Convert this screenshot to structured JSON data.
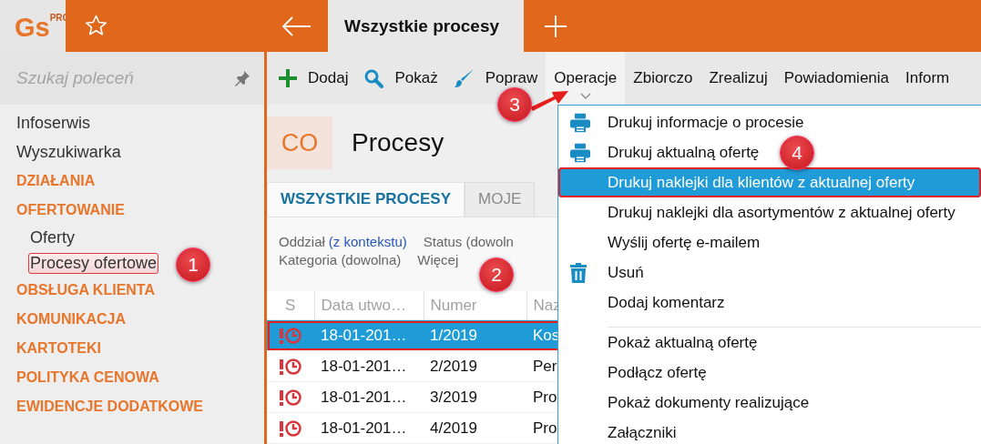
{
  "app": {
    "logo": "Gs",
    "logo_badge": "PRO"
  },
  "top_tabs": [
    {
      "label": "Wszystkie procesy",
      "selected": true
    }
  ],
  "search": {
    "placeholder": "Szukaj poleceń"
  },
  "toolbar": [
    {
      "label": "Dodaj",
      "kind": "add",
      "expanded": false
    },
    {
      "label": "Pokaż",
      "kind": "view",
      "expanded": false
    },
    {
      "label": "Popraw",
      "kind": "edit",
      "expanded": false
    },
    {
      "label": "Operacje",
      "kind": "text",
      "expanded": true
    },
    {
      "label": "Zbiorczo",
      "kind": "text",
      "expanded": false
    },
    {
      "label": "Zrealizuj",
      "kind": "text",
      "expanded": false
    },
    {
      "label": "Powiadomienia",
      "kind": "text",
      "expanded": false
    },
    {
      "label": "Inform",
      "kind": "text",
      "expanded": false
    }
  ],
  "sidebar": {
    "items": [
      {
        "label": "Infoserwis",
        "kind": "link",
        "outlined": false
      },
      {
        "label": "Wyszukiwarka",
        "kind": "link",
        "outlined": false
      },
      {
        "label": "DZIAŁANIA",
        "kind": "section",
        "outlined": false
      },
      {
        "label": "OFERTOWANIE",
        "kind": "section",
        "outlined": false,
        "children": [
          {
            "label": "Oferty",
            "kind": "link",
            "outlined": false
          },
          {
            "label": "Procesy ofertowe",
            "kind": "link",
            "outlined": true
          }
        ]
      },
      {
        "label": "OBSŁUGA KLIENTA",
        "kind": "section",
        "outlined": false
      },
      {
        "label": "KOMUNIKACJA",
        "kind": "section",
        "outlined": false
      },
      {
        "label": "KARTOTEKI",
        "kind": "section",
        "outlined": false
      },
      {
        "label": "POLITYKA CENOWA",
        "kind": "section",
        "outlined": false
      },
      {
        "label": "EWIDENCJE DODATKOWE",
        "kind": "section",
        "outlined": false
      }
    ]
  },
  "content": {
    "badge": "CO",
    "title": "Procesy",
    "tabs": [
      {
        "label": "WSZYSTKIE PROCESY",
        "selected": true
      },
      {
        "label": "MOJE",
        "selected": false
      }
    ],
    "filters": [
      [
        {
          "label": "Oddział",
          "value": "(z kontekstu)"
        },
        {
          "label": "Status (dowoln"
        }
      ],
      [
        {
          "label": "Kategoria (dowolna)"
        },
        {
          "label": "Więcej"
        }
      ]
    ]
  },
  "table": {
    "status_column": "S",
    "columns": [
      "Data utwo…",
      "Numer",
      "Naz"
    ],
    "rows": [
      {
        "kind": "alert",
        "cells": [
          "18-01-201…",
          "1/2019",
          "Kos"
        ],
        "selected": true,
        "outlined": true
      },
      {
        "kind": "alert",
        "cells": [
          "18-01-201…",
          "2/2019",
          "Per"
        ],
        "selected": false,
        "outlined": false
      },
      {
        "kind": "alert",
        "cells": [
          "18-01-201…",
          "3/2019",
          "Pro"
        ],
        "selected": false,
        "outlined": false
      },
      {
        "kind": "alert",
        "cells": [
          "18-01-201…",
          "4/2019",
          "Pro"
        ],
        "selected": false,
        "outlined": false
      }
    ]
  },
  "menu": {
    "items": [
      {
        "label": "Drukuj informacje o procesie",
        "kind": "print",
        "selected": false,
        "outlined": false
      },
      {
        "label": "Drukuj aktualną ofertę",
        "kind": "print",
        "selected": false,
        "outlined": false
      },
      {
        "label": "Drukuj naklejki dla klientów z aktualnej oferty",
        "kind": "plain",
        "selected": true,
        "outlined": true
      },
      {
        "label": "Drukuj naklejki dla asortymentów z aktualnej oferty",
        "kind": "plain",
        "selected": false,
        "outlined": false
      },
      {
        "label": "Wyślij ofertę e-mailem",
        "kind": "plain",
        "selected": false,
        "outlined": false
      },
      {
        "label": "Usuń",
        "kind": "delete",
        "selected": false,
        "outlined": false
      },
      {
        "label": "Dodaj komentarz",
        "kind": "plain",
        "selected": false,
        "outlined": false
      },
      {
        "kind": "separator"
      },
      {
        "label": "Pokaż aktualną ofertę",
        "kind": "plain",
        "selected": false,
        "outlined": false
      },
      {
        "label": "Podłącz ofertę",
        "kind": "plain",
        "selected": false,
        "outlined": false
      },
      {
        "label": "Pokaż dokumenty realizujące",
        "kind": "plain",
        "selected": false,
        "outlined": false
      },
      {
        "label": "Załączniki",
        "kind": "plain",
        "selected": false,
        "outlined": false
      }
    ]
  },
  "annotations": [
    {
      "label": "1",
      "kind": "plain"
    },
    {
      "label": "2",
      "kind": "plain"
    },
    {
      "label": "3",
      "kind": "arrow"
    },
    {
      "label": "4",
      "kind": "plain"
    }
  ]
}
